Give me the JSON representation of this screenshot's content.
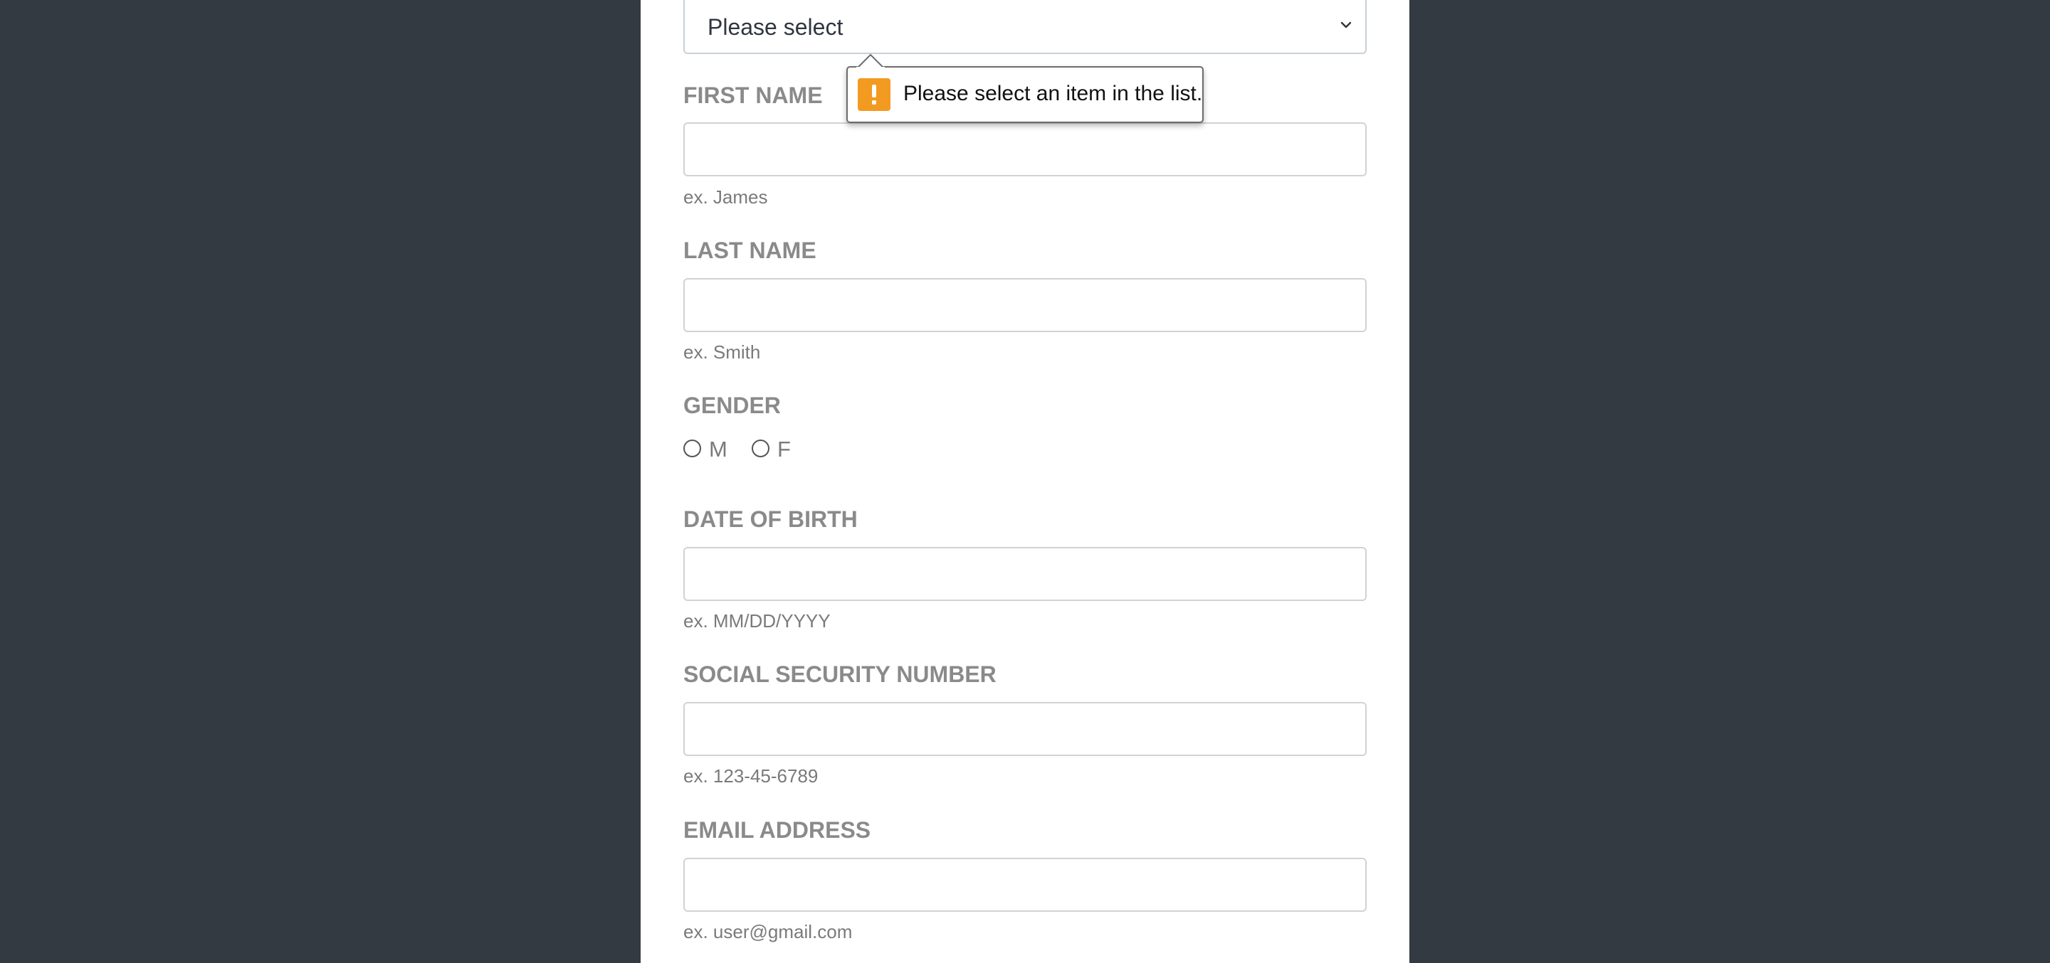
{
  "form": {
    "select": {
      "value": "Please select"
    },
    "validation_tooltip": {
      "message": "Please select an item in the list.",
      "icon": "warning-exclamation-icon",
      "icon_color": "#f39a21"
    },
    "first_name": {
      "label": "FIRST NAME",
      "value": "",
      "hint": "ex. James"
    },
    "last_name": {
      "label": "LAST NAME",
      "value": "",
      "hint": "ex. Smith"
    },
    "gender": {
      "label": "GENDER",
      "options": [
        "M",
        "F"
      ]
    },
    "date_of_birth": {
      "label": "DATE OF BIRTH",
      "value": "",
      "hint": "ex. MM/DD/YYYY"
    },
    "ssn": {
      "label": "SOCIAL SECURITY NUMBER",
      "value": "",
      "hint": "ex. 123-45-6789"
    },
    "email": {
      "label": "EMAIL ADDRESS",
      "value": "",
      "hint": "ex. user@gmail.com"
    }
  },
  "colors": {
    "background": "#343a42",
    "panel": "#ffffff",
    "label": "#8a8a8a",
    "hint": "#7a7a7a",
    "input_border": "#cfd3d7"
  }
}
